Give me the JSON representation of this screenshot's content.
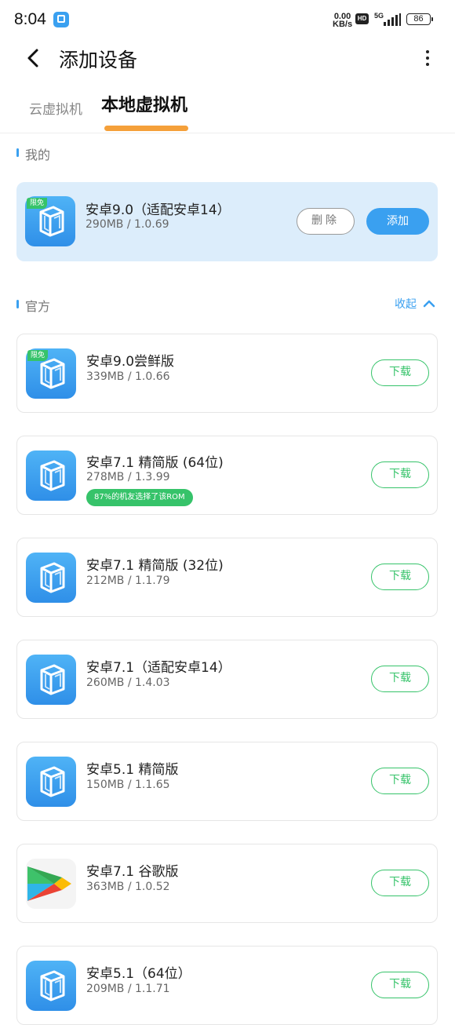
{
  "status_bar": {
    "time": "8:04",
    "net_speed": "0.00",
    "net_unit": "KB/s",
    "hd": "HD",
    "network": "5G",
    "battery": "86"
  },
  "header": {
    "title": "添加设备"
  },
  "tabs": [
    {
      "label": "云虚拟机",
      "active": false
    },
    {
      "label": "本地虚拟机",
      "active": true
    }
  ],
  "mine_section": {
    "label": "我的",
    "item": {
      "badge": "限免",
      "name": "安卓9.0（适配安卓14）",
      "meta": "290MB / 1.0.69",
      "delete_label": "删除",
      "add_label": "添加"
    }
  },
  "official_section": {
    "label": "官方",
    "collapse_label": "收起",
    "items": [
      {
        "badge": "限免",
        "name": "安卓9.0尝鲜版",
        "meta": "339MB / 1.0.66",
        "tag": "",
        "icon": "vm-cube-icon",
        "action": "下载"
      },
      {
        "badge": "",
        "name": "安卓7.1 精简版 (64位)",
        "meta": "278MB / 1.3.99",
        "tag": "87%的机友选择了该ROM",
        "icon": "vm-cube-icon",
        "action": "下载"
      },
      {
        "badge": "",
        "name": "安卓7.1 精简版 (32位)",
        "meta": "212MB / 1.1.79",
        "tag": "",
        "icon": "vm-cube-icon",
        "action": "下载"
      },
      {
        "badge": "",
        "name": "安卓7.1（适配安卓14）",
        "meta": "260MB / 1.4.03",
        "tag": "",
        "icon": "vm-cube-icon",
        "action": "下载"
      },
      {
        "badge": "",
        "name": "安卓5.1 精简版",
        "meta": "150MB / 1.1.65",
        "tag": "",
        "icon": "vm-cube-icon",
        "action": "下载"
      },
      {
        "badge": "",
        "name": "安卓7.1 谷歌版",
        "meta": "363MB / 1.0.52",
        "tag": "",
        "icon": "play-store-icon",
        "action": "下载"
      },
      {
        "badge": "",
        "name": "安卓5.1（64位）",
        "meta": "209MB / 1.1.71",
        "tag": "",
        "icon": "vm-cube-icon",
        "action": "下载"
      }
    ]
  },
  "colors": {
    "accent_blue": "#3aa0f0",
    "download_green": "#36c36a",
    "tab_underline": "#f5a03a",
    "mine_card_bg": "#dcedfb"
  }
}
